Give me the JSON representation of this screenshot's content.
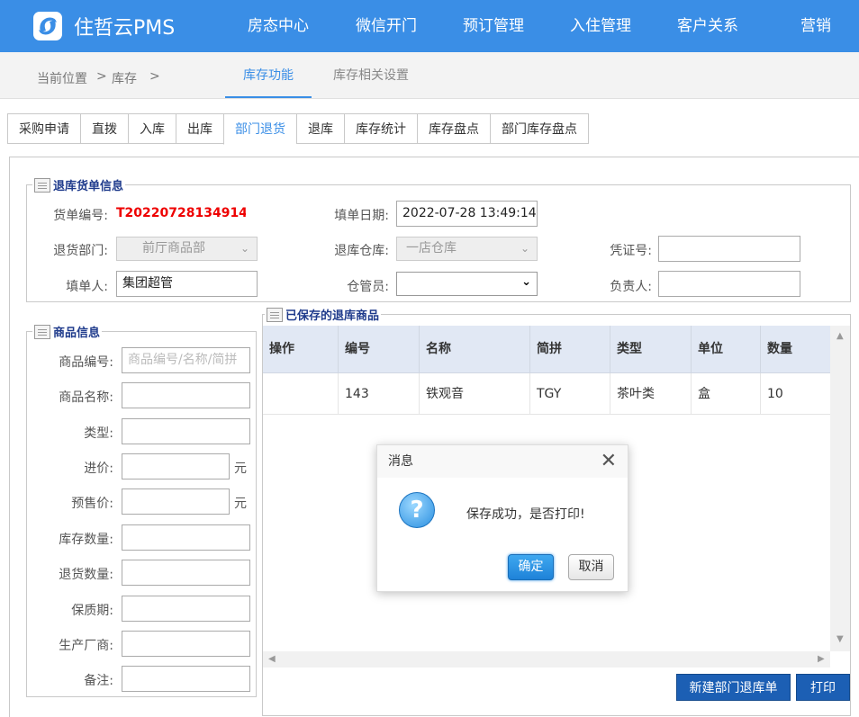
{
  "app": {
    "name": "住哲云PMS"
  },
  "nav": [
    "房态中心",
    "微信开门",
    "预订管理",
    "入住管理",
    "客户关系",
    "营销"
  ],
  "breadcrumb": {
    "current_label": "当前位置",
    "sep1": ">",
    "item": "库存",
    "sep2": ">"
  },
  "function_tabs": [
    "库存功能",
    "库存相关设置"
  ],
  "sub_tabs": [
    "采购申请",
    "直拨",
    "入库",
    "出库",
    "部门退货",
    "退库",
    "库存统计",
    "库存盘点",
    "部门库存盘点"
  ],
  "order_info": {
    "legend": "退库货单信息",
    "order_no_label": "货单编号:",
    "order_no": "T20220728134914(",
    "fill_date_label": "填单日期:",
    "fill_date": "2022-07-28 13:49:14",
    "dept_label": "退货部门:",
    "dept": "前厅商品部",
    "warehouse_label": "退库仓库:",
    "warehouse": "一店仓库",
    "voucher_label": "凭证号:",
    "voucher": "",
    "filler_label": "填单人:",
    "filler": "集团超管",
    "keeper_label": "仓管员:",
    "keeper": "",
    "owner_label": "负责人:",
    "owner": ""
  },
  "goods_info": {
    "legend": "商品信息",
    "fields": [
      {
        "label": "商品编号:",
        "placeholder": "商品编号/名称/简拼"
      },
      {
        "label": "商品名称:",
        "placeholder": ""
      },
      {
        "label": "类型:",
        "placeholder": ""
      },
      {
        "label": "进价:",
        "placeholder": ""
      },
      {
        "label": "预售价:",
        "placeholder": ""
      },
      {
        "label": "库存数量:",
        "placeholder": ""
      },
      {
        "label": "退货数量:",
        "placeholder": ""
      },
      {
        "label": "保质期:",
        "placeholder": ""
      },
      {
        "label": "生产厂商:",
        "placeholder": ""
      },
      {
        "label": "备注:",
        "placeholder": ""
      }
    ],
    "unit": "元"
  },
  "saved_goods": {
    "legend": "已保存的退库商品",
    "columns": [
      "操作",
      "编号",
      "名称",
      "简拼",
      "类型",
      "单位",
      "数量"
    ],
    "rows": [
      [
        "",
        "143",
        "铁观音",
        "TGY",
        "茶叶类",
        "盒",
        "10"
      ]
    ]
  },
  "buttons": {
    "new": "新建部门退库单",
    "print": "打印"
  },
  "dialog": {
    "title": "消息",
    "message": "保存成功，是否打印!",
    "ok": "确定",
    "cancel": "取消"
  }
}
